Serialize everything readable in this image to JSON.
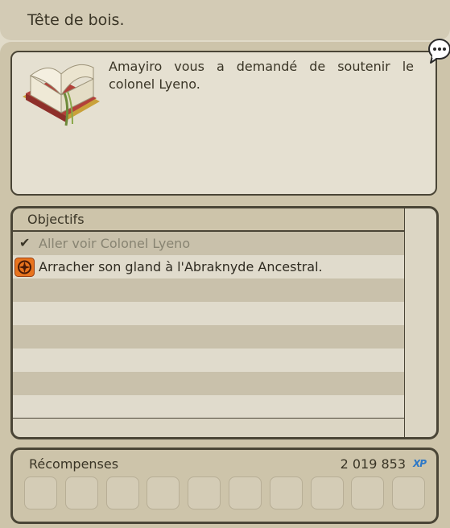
{
  "quest": {
    "title": "Tête de bois.",
    "description": "Amayiro vous a demandé de soutenir le colonel Lyeno."
  },
  "objectives": {
    "header": "Objectifs",
    "items": [
      {
        "label": "Aller voir Colonel Lyeno",
        "done": true,
        "icon": "check-icon"
      },
      {
        "label": "Arracher son gland à l'Abraknyde Ancestral.",
        "done": false,
        "icon": "compass-icon"
      }
    ]
  },
  "rewards": {
    "label": "Récompenses",
    "xp": "2 019 853",
    "xp_icon_text": "XP",
    "slots": 10
  },
  "icons": {
    "quest_book": "quest-book-icon",
    "speech": "speech-bubble-icon"
  },
  "colors": {
    "accent_xp": "#2c78c8",
    "compass": "#e8741e"
  }
}
